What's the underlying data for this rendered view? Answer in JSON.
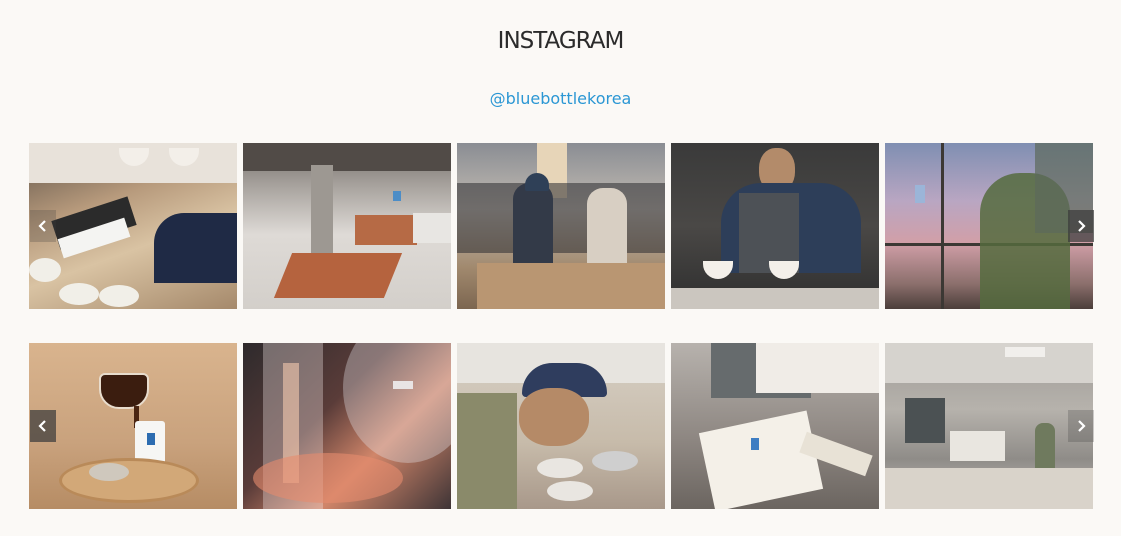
{
  "header": {
    "title": "INSTAGRAM",
    "handle": "@bluebottlekorea"
  },
  "colors": {
    "background": "#fbf9f6",
    "link": "#2b97d4"
  },
  "carousels": [
    {
      "name": "carousel-row-1",
      "photos": [
        "coffee-cupping-photo",
        "brick-counter-cafe-photo",
        "barista-crowd-photo",
        "barista-pour-over-photo",
        "window-logo-sunset-photo"
      ],
      "icons": {
        "prev": "chevron-left-icon",
        "next": "chevron-right-icon"
      }
    },
    {
      "name": "carousel-row-2",
      "photos": [
        "pouring-coffee-cup-photo",
        "glass-dripper-photo",
        "cupping-smell-photo",
        "drip-bag-package-photo",
        "roastery-workers-photo"
      ],
      "icons": {
        "prev": "chevron-left-icon",
        "next": "chevron-right-icon"
      }
    }
  ]
}
